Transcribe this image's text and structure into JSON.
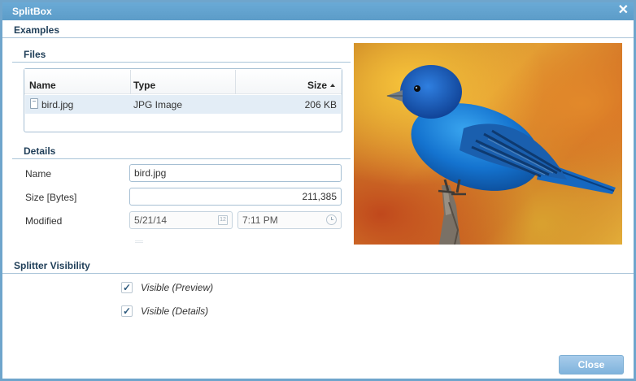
{
  "window": {
    "title": "SplitBox",
    "close_glyph": "✕"
  },
  "sections": {
    "examples": "Examples",
    "files": "Files",
    "details": "Details",
    "splitter_visibility": "Splitter Visibility"
  },
  "files_grid": {
    "columns": [
      "Name",
      "Type",
      "Size"
    ],
    "sort_column": "Size",
    "sort_direction": "ascending",
    "rows": [
      {
        "name": "bird.jpg",
        "type": "JPG Image",
        "size": "206 KB",
        "selected": true
      }
    ]
  },
  "details": {
    "name_label": "Name",
    "name_value": "bird.jpg",
    "size_label": "Size [Bytes]",
    "size_value": "211,385",
    "modified_label": "Modified",
    "modified_date": "5/21/14",
    "modified_time": "7:11 PM",
    "calendar_icon_text": "12"
  },
  "preview": {
    "icon": "bird-image",
    "subject": "blue bird on branch"
  },
  "visibility": {
    "preview_label": "Visible (Preview)",
    "preview_checked": true,
    "details_label": "Visible (Details)",
    "details_checked": true,
    "check_glyph": "✓"
  },
  "footer": {
    "close_label": "Close"
  },
  "colors": {
    "title_bar": "#5c9cc8",
    "border": "#6fa5cc",
    "selected_row": "#e3edf6",
    "button": "#7fb3dc"
  }
}
